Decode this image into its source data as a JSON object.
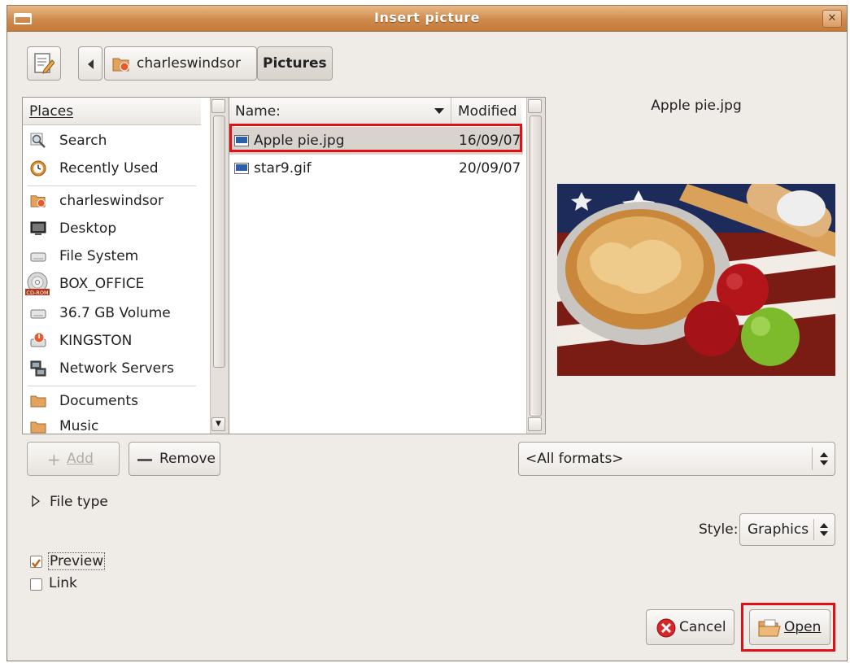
{
  "window": {
    "title": "Insert picture"
  },
  "pathbar": {
    "crumbs": [
      "charleswindsor",
      "Pictures"
    ]
  },
  "places": {
    "header": "Places",
    "items": [
      "Search",
      "Recently Used",
      "charleswindsor",
      "Desktop",
      "File System",
      "BOX_OFFICE",
      "36.7 GB Volume",
      "KINGSTON",
      "Network Servers",
      "Documents",
      "Music"
    ],
    "cdrom_badge": "CD-ROM"
  },
  "files": {
    "col_name": "Name:",
    "col_modified": "Modified",
    "rows": [
      {
        "name": "Apple pie.jpg",
        "modified": "16/09/07"
      },
      {
        "name": "star9.gif",
        "modified": "20/09/07"
      }
    ]
  },
  "preview": {
    "filename": "Apple pie.jpg"
  },
  "buttons": {
    "add": "Add",
    "remove": "Remove",
    "cancel": "Cancel",
    "open": "Open"
  },
  "filter": {
    "selected": "<All formats>"
  },
  "file_type": {
    "label": "File type"
  },
  "style": {
    "label": "Style:",
    "value": "Graphics"
  },
  "options": {
    "preview_label": "Preview",
    "preview_checked": true,
    "link_label": "Link",
    "link_checked": false
  },
  "colors": {
    "title_bar": "#d08b4c",
    "highlight": "#e01016",
    "selection": "#d9d3cd"
  }
}
